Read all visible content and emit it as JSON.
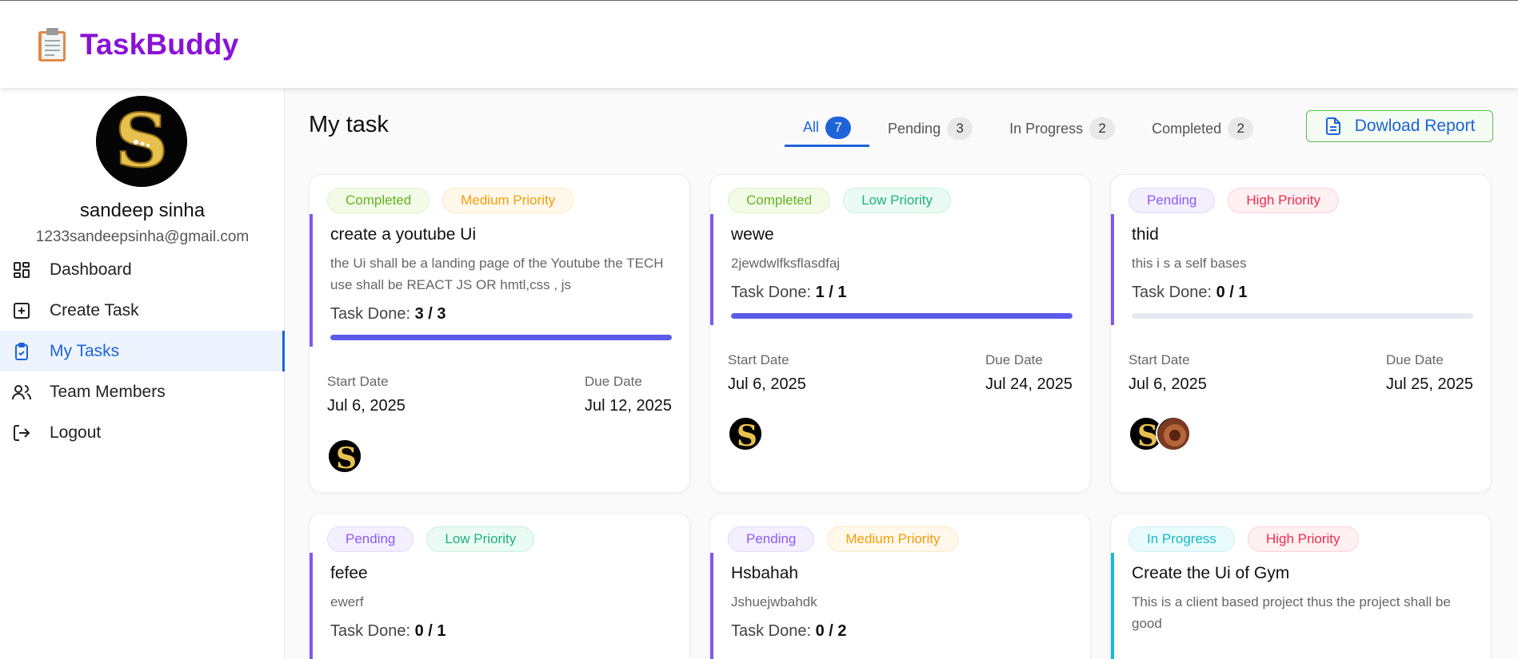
{
  "app": {
    "brand": "TaskBuddy",
    "logo_icon": "clipboard-icon",
    "brand_color": "#8a12d6"
  },
  "user": {
    "name": "sandeep sinha",
    "email": "1233sandeepsinha@gmail.com"
  },
  "sidebar": {
    "items": [
      {
        "label": "Dashboard",
        "icon": "dashboard-icon"
      },
      {
        "label": "Create Task",
        "icon": "plus-square-icon"
      },
      {
        "label": "My Tasks",
        "icon": "clipboard-check-icon",
        "active": true
      },
      {
        "label": "Team Members",
        "icon": "users-icon"
      },
      {
        "label": "Logout",
        "icon": "logout-icon"
      }
    ]
  },
  "main": {
    "title": "My task",
    "tabs": [
      {
        "label": "All",
        "count": "7",
        "active": true
      },
      {
        "label": "Pending",
        "count": "3"
      },
      {
        "label": "In Progress",
        "count": "2"
      },
      {
        "label": "Completed",
        "count": "2"
      }
    ],
    "report_button": "Dowload Report"
  },
  "labels": {
    "task_done": "Task Done:",
    "start_date": "Start Date",
    "due_date": "Due Date"
  },
  "tasks": [
    {
      "status": "Completed",
      "priority": "Medium Priority",
      "title": "create a youtube Ui",
      "description": "the Ui shall be a landing page of the Youtube the TECH use shall be REACT JS OR hmtl,css , js",
      "done": "3 / 3",
      "progress": 1.0,
      "start": "Jul 6, 2025",
      "due": "Jul 12, 2025"
    },
    {
      "status": "Completed",
      "priority": "Low Priority",
      "title": "wewe",
      "description": "2jewdwlfksflasdfaj",
      "done": "1 / 1",
      "progress": 1.0,
      "start": "Jul 6, 2025",
      "due": "Jul 24, 2025"
    },
    {
      "status": "Pending",
      "priority": "High Priority",
      "title": "thid",
      "description": "this i s a self bases",
      "done": "0 / 1",
      "progress": 0.0,
      "start": "Jul 6, 2025",
      "due": "Jul 25, 2025"
    },
    {
      "status": "Pending",
      "priority": "Low Priority",
      "title": "fefee",
      "description": "ewerf",
      "done": "0 / 1"
    },
    {
      "status": "Pending",
      "priority": "Medium Priority",
      "title": "Hsbahah",
      "description": "Jshuejwbahdk",
      "done": "0 / 2"
    },
    {
      "status": "In Progress",
      "priority": "High Priority",
      "title": "Create the Ui of Gym",
      "description": "This is a client based project thus the project shall be good"
    }
  ],
  "colors": {
    "accent": "#1e63d8",
    "progress": "#5b5be8",
    "card_border": "#7c5cf0"
  }
}
